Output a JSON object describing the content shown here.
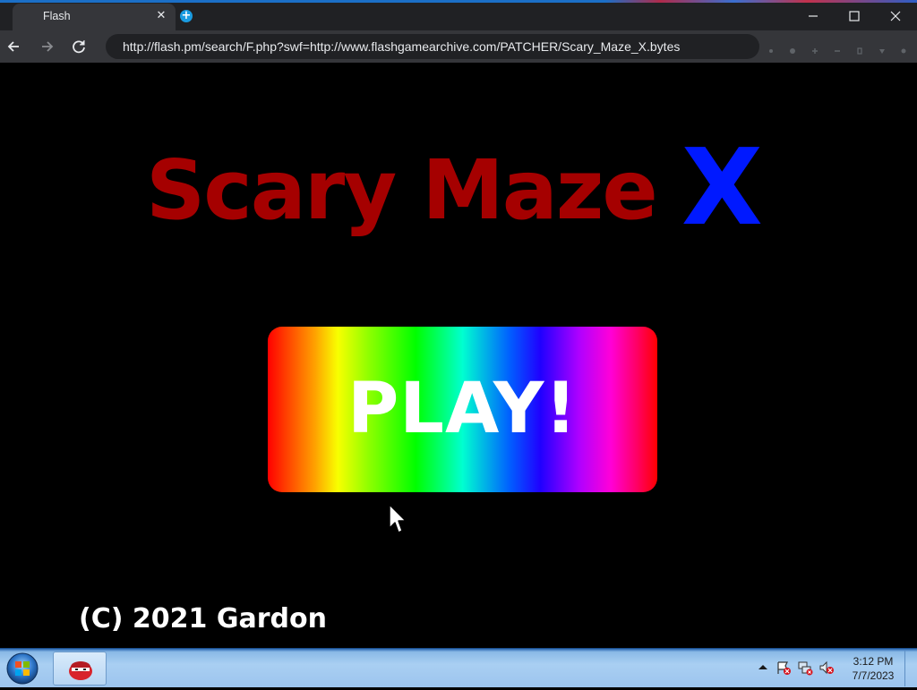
{
  "browser": {
    "tab_title": "Flash",
    "address_url": "http://flash.pm/search/F.php?swf=http://www.flashgamearchive.com/PATCHER/Scary_Maze_X.bytes"
  },
  "game": {
    "title_main": "Scary Maze",
    "title_x": "X",
    "play_label": "PLAY!",
    "copyright": "(C) 2021 Gardon",
    "colors": {
      "title_main": "#a50000",
      "title_x": "#0019ff",
      "background": "#000000"
    }
  },
  "taskbar": {
    "clock_time": "3:12 PM",
    "clock_date": "7/7/2023"
  }
}
